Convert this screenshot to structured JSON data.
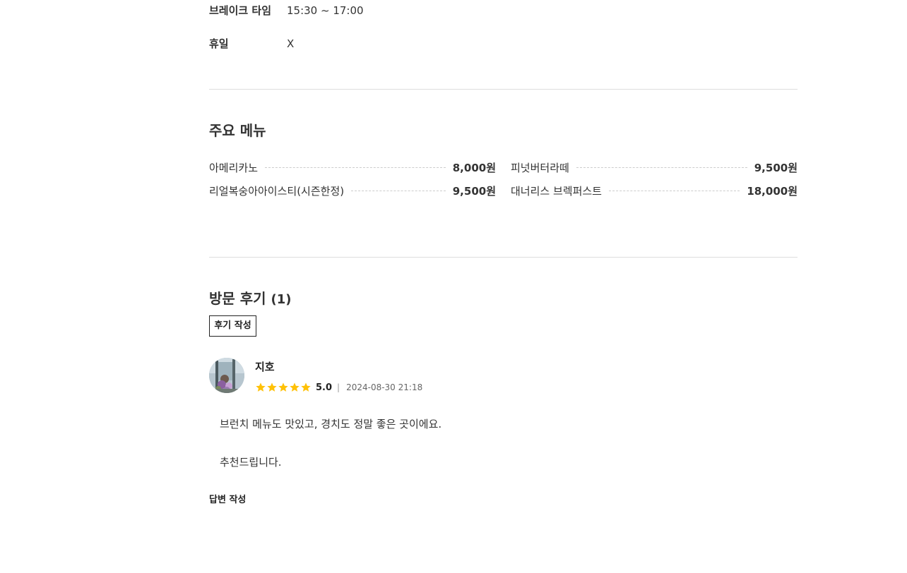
{
  "hours": {
    "break_time": {
      "label": "브레이크 타임",
      "value": "15:30 ~ 17:00"
    },
    "holiday": {
      "label": "휴일",
      "value": "X"
    }
  },
  "menu_section": {
    "title": "주요 메뉴",
    "items": [
      {
        "name": "아메리카노",
        "price": "8,000원"
      },
      {
        "name": "피넛버터라떼",
        "price": "9,500원"
      },
      {
        "name": "리얼복숭아아이스티(시즌한정)",
        "price": "9,500원"
      },
      {
        "name": "대너리스 브렉퍼스트",
        "price": "18,000원"
      }
    ]
  },
  "review_section": {
    "title": "방문 후기",
    "count": "(1)",
    "write_button": "후기 작성",
    "reviews": [
      {
        "author": "지호",
        "rating": 5.0,
        "rating_text": "5.0",
        "separator": "|",
        "date": "2024-08-30 21:18",
        "lines": [
          "브런치 메뉴도 맛있고, 경치도 정말 좋은 곳이에요.",
          "추천드립니다."
        ],
        "reply_label": "답변 작성"
      }
    ]
  },
  "colors": {
    "star": "#FFC107",
    "text": "#333333",
    "divider": "#dddddd"
  },
  "icons": {
    "star": "star-icon",
    "avatar": "user-avatar-photo"
  }
}
